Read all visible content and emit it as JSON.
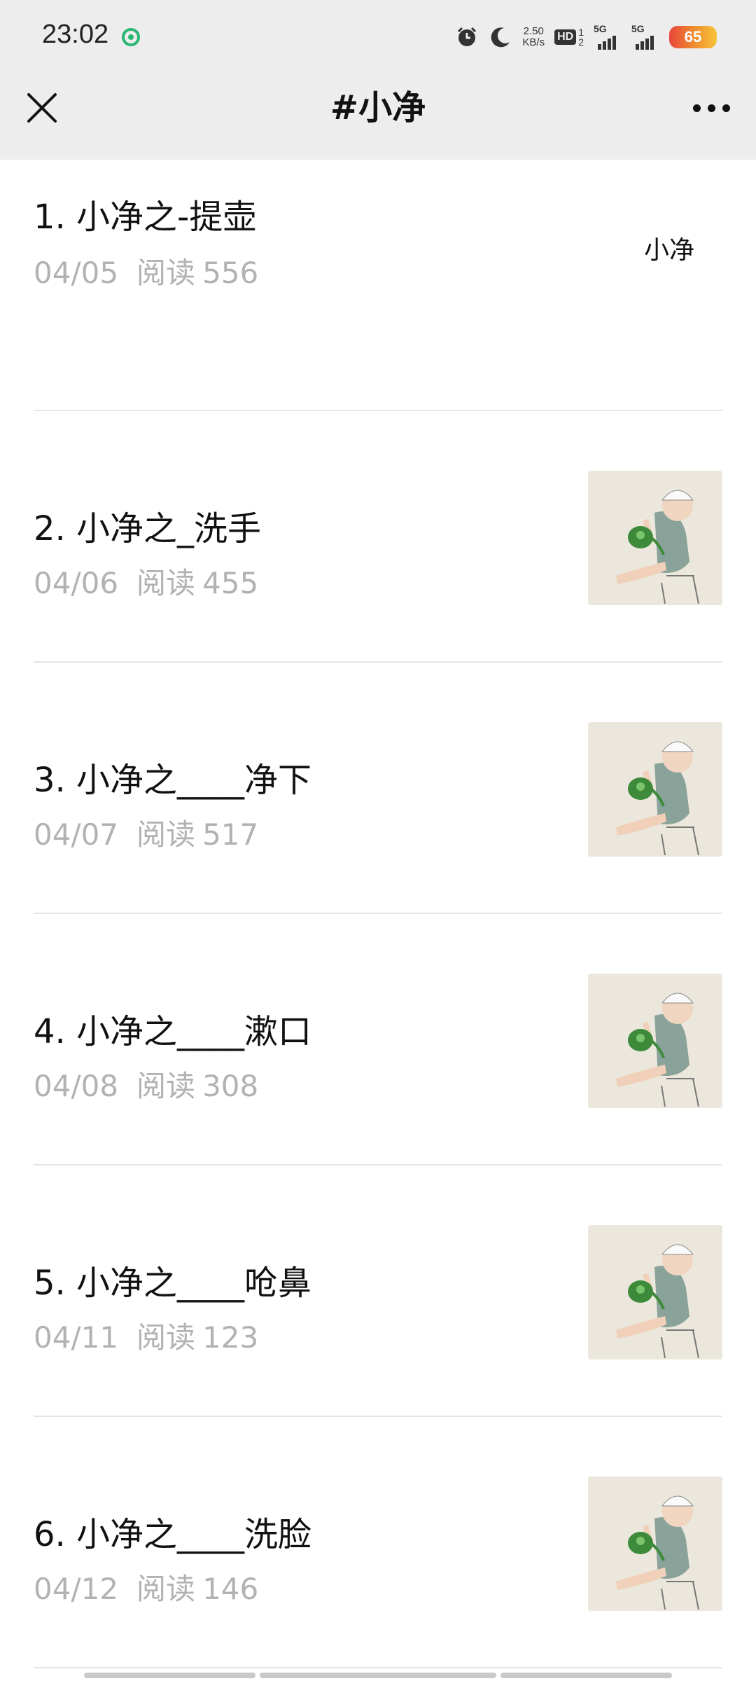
{
  "status": {
    "time": "23:02",
    "net_speed_value": "2.50",
    "net_speed_unit": "KB/s",
    "hd_label": "HD",
    "sim_label_top": "1",
    "sim_label_bottom": "2",
    "signal1_label": "5G",
    "signal2_label": "5G",
    "battery": "65",
    "icons": [
      "app-notification-icon",
      "alarm-icon",
      "moon-icon"
    ]
  },
  "nav": {
    "title": "#小净",
    "close_icon": "close-icon",
    "more_icon": "more-icon"
  },
  "articles": [
    {
      "title": "1. 小净之-提壶",
      "date": "04/05",
      "views_label": "阅读",
      "views": "556",
      "thumb": "text",
      "thumb_text": "小净"
    },
    {
      "title": "2. 小净之_洗手",
      "date": "04/06",
      "views_label": "阅读",
      "views": "455",
      "thumb": "boy-with-kettle"
    },
    {
      "title": "3. 小净之____净下",
      "date": "04/07",
      "views_label": "阅读",
      "views": "517",
      "thumb": "boy-with-kettle"
    },
    {
      "title": "4. 小净之____漱口",
      "date": "04/08",
      "views_label": "阅读",
      "views": "308",
      "thumb": "boy-with-kettle"
    },
    {
      "title": "5. 小净之____呛鼻",
      "date": "04/11",
      "views_label": "阅读",
      "views": "123",
      "thumb": "boy-with-kettle"
    },
    {
      "title": "6. 小净之____洗脸",
      "date": "04/12",
      "views_label": "阅读",
      "views": "146",
      "thumb": "boy-with-kettle"
    }
  ],
  "colors": {
    "bar_bg": "#ededed",
    "title_text": "#111111",
    "meta_text": "#b2b2b2",
    "divider": "#e5e5e5",
    "battery_red": "#e8453c",
    "battery_yellow": "#f7c43a",
    "kettle_green": "#3c8a3a"
  }
}
